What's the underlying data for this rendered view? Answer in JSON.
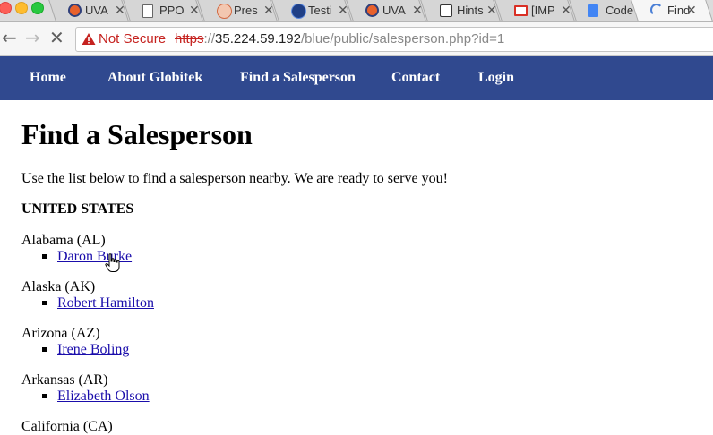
{
  "browser": {
    "tabs": [
      {
        "title": "UVA",
        "favicon": "uva-icon"
      },
      {
        "title": "PPO",
        "favicon": "page-icon"
      },
      {
        "title": "Pres",
        "favicon": "pres-icon"
      },
      {
        "title": "Testi",
        "favicon": "globe-icon"
      },
      {
        "title": "UVA",
        "favicon": "uva-icon"
      },
      {
        "title": "Hints",
        "favicon": "c-icon"
      },
      {
        "title": "[IMP",
        "favicon": "gmail-icon"
      },
      {
        "title": "Code",
        "favicon": "docs-icon"
      },
      {
        "title": "Find",
        "favicon": "loading-icon"
      }
    ],
    "address": {
      "security_label": "Not Secure",
      "scheme": "https",
      "separator": "://",
      "host": "35.224.59.192",
      "path": "/blue/public/salesperson.php?id=1"
    }
  },
  "nav": {
    "items": [
      "Home",
      "About Globitek",
      "Find a Salesperson",
      "Contact",
      "Login"
    ]
  },
  "page": {
    "title": "Find a Salesperson",
    "intro": "Use the list below to find a salesperson nearby. We are ready to serve you!",
    "country": "UNITED STATES",
    "states": [
      {
        "name": "Alabama (AL)",
        "person": "Daron Burke"
      },
      {
        "name": "Alaska (AK)",
        "person": "Robert Hamilton"
      },
      {
        "name": "Arizona (AZ)",
        "person": "Irene Boling"
      },
      {
        "name": "Arkansas (AR)",
        "person": "Elizabeth Olson"
      },
      {
        "name": "California (CA)"
      }
    ]
  },
  "colors": {
    "nav_bg": "#30498f",
    "link": "#1a0dab",
    "warning": "#c5221f"
  }
}
